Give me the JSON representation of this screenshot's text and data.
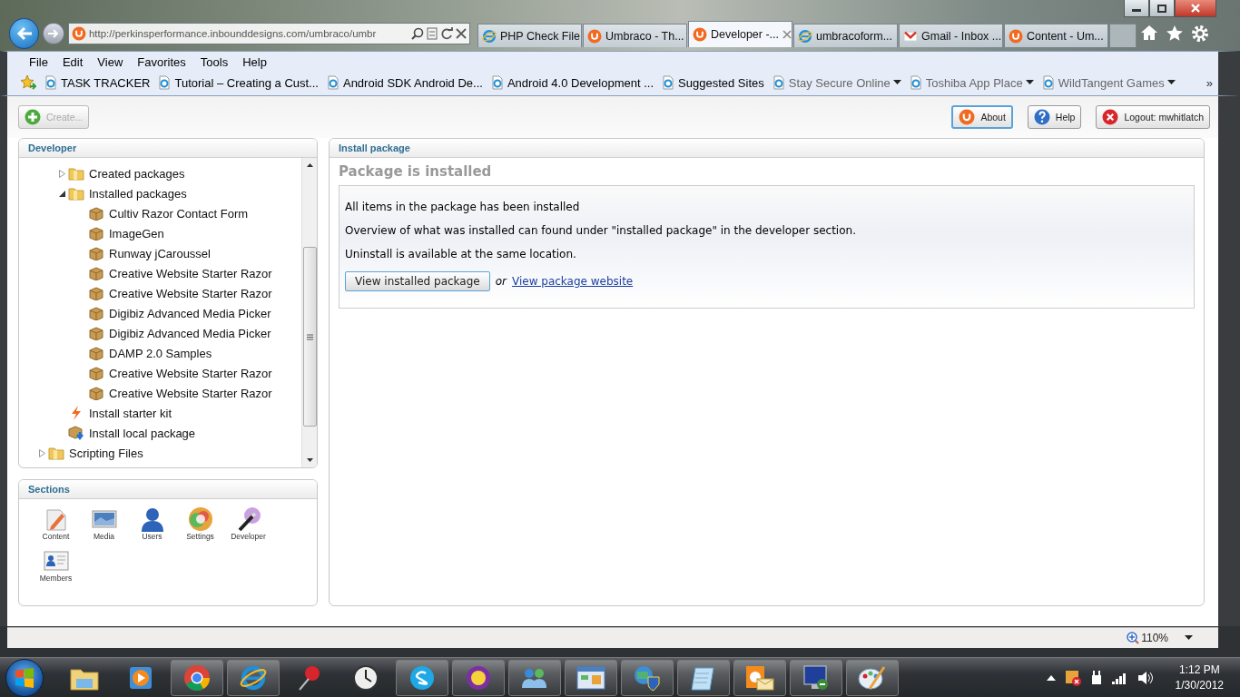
{
  "browser": {
    "address": "http://perkinsperformance.inbounddesigns.com/umbraco/umbr",
    "tabs": [
      {
        "title": "PHP Check File",
        "kind": "ie",
        "selected": false
      },
      {
        "title": "Umbraco - Th...",
        "kind": "umbraco",
        "selected": false
      },
      {
        "title": "Developer -...",
        "kind": "umbraco",
        "selected": true
      },
      {
        "title": "umbracoform...",
        "kind": "ie",
        "selected": false
      },
      {
        "title": "Gmail - Inbox ...",
        "kind": "gmail",
        "selected": false
      },
      {
        "title": "Content - Um...",
        "kind": "umbraco",
        "selected": false
      }
    ],
    "menu": [
      "File",
      "Edit",
      "View",
      "Favorites",
      "Tools",
      "Help"
    ],
    "favorites": [
      {
        "label": "TASK TRACKER",
        "dimmed": false,
        "dropdown": false
      },
      {
        "label": "Tutorial – Creating a Cust...",
        "dimmed": false,
        "dropdown": false
      },
      {
        "label": "Android SDK  Android De...",
        "dimmed": false,
        "dropdown": false
      },
      {
        "label": "Android 4.0 Development ...",
        "dimmed": false,
        "dropdown": false
      },
      {
        "label": "Suggested Sites",
        "dimmed": false,
        "dropdown": false
      },
      {
        "label": "Stay Secure Online",
        "dimmed": true,
        "dropdown": true
      },
      {
        "label": "Toshiba App Place",
        "dimmed": true,
        "dropdown": true
      },
      {
        "label": "WildTangent Games",
        "dimmed": true,
        "dropdown": true
      }
    ],
    "chevron": "»",
    "zoom": "110%"
  },
  "toolbar": {
    "create": {
      "label": "Create...",
      "disabled": true
    },
    "buttons": [
      {
        "label": "About",
        "kind": "umbraco",
        "highlighted": true
      },
      {
        "label": "Help",
        "kind": "help",
        "highlighted": false
      },
      {
        "label": "Logout: mwhitlatch",
        "kind": "logout",
        "highlighted": false
      }
    ]
  },
  "tree": {
    "title": "Developer",
    "items": [
      {
        "children": [
          {
            "label": "Created packages",
            "kind": "folder",
            "expanded": false
          },
          {
            "label": "Installed packages",
            "kind": "folder",
            "expanded": true,
            "children": [
              {
                "label": "Cultiv Razor Contact Form",
                "kind": "package"
              },
              {
                "label": "ImageGen",
                "kind": "package"
              },
              {
                "label": "Runway jCaroussel",
                "kind": "package"
              },
              {
                "label": "Creative Website Starter Razor",
                "kind": "package"
              },
              {
                "label": "Creative Website Starter Razor",
                "kind": "package"
              },
              {
                "label": "Digibiz Advanced Media Picker",
                "kind": "package"
              },
              {
                "label": "Digibiz Advanced Media Picker",
                "kind": "package"
              },
              {
                "label": "DAMP 2.0 Samples",
                "kind": "package"
              },
              {
                "label": "Creative Website Starter Razor",
                "kind": "package"
              },
              {
                "label": "Creative Website Starter Razor",
                "kind": "package"
              }
            ]
          },
          {
            "label": "Install starter kit",
            "kind": "starter"
          },
          {
            "label": "Install local package",
            "kind": "install"
          }
        ]
      },
      {
        "label": "Scripting Files",
        "kind": "folder",
        "expanded": false
      }
    ]
  },
  "sections": {
    "title": "Sections",
    "items": [
      {
        "label": "Content",
        "kind": "content"
      },
      {
        "label": "Media",
        "kind": "media"
      },
      {
        "label": "Users",
        "kind": "users"
      },
      {
        "label": "Settings",
        "kind": "settings"
      },
      {
        "label": "Developer",
        "kind": "developer"
      },
      {
        "label": "Members",
        "kind": "members"
      }
    ]
  },
  "main": {
    "title": "Install package",
    "heading": "Package is installed",
    "paragraphs": [
      "All items in the package has been installed",
      "Overview of what was installed can found under \"installed package\" in the developer section.",
      "Uninstall is available at the same location."
    ],
    "button": "View installed package",
    "or": "or",
    "link": "View package website"
  },
  "taskbar": {
    "apps": [
      {
        "kind": "explorer",
        "running": false
      },
      {
        "kind": "player",
        "running": false
      },
      {
        "kind": "chrome",
        "running": true
      },
      {
        "kind": "ie",
        "running": true
      },
      {
        "kind": "pin",
        "running": false
      },
      {
        "kind": "clock",
        "running": false
      },
      {
        "kind": "skype",
        "running": true
      },
      {
        "kind": "yahoo",
        "running": true
      },
      {
        "kind": "people",
        "running": true
      },
      {
        "kind": "panel",
        "running": true
      },
      {
        "kind": "globe",
        "running": true
      },
      {
        "kind": "notepad",
        "running": true
      },
      {
        "kind": "outlook",
        "running": true
      },
      {
        "kind": "remote",
        "running": true
      },
      {
        "kind": "paint",
        "running": true
      }
    ],
    "time": "1:12 PM",
    "date": "1/30/2012"
  }
}
